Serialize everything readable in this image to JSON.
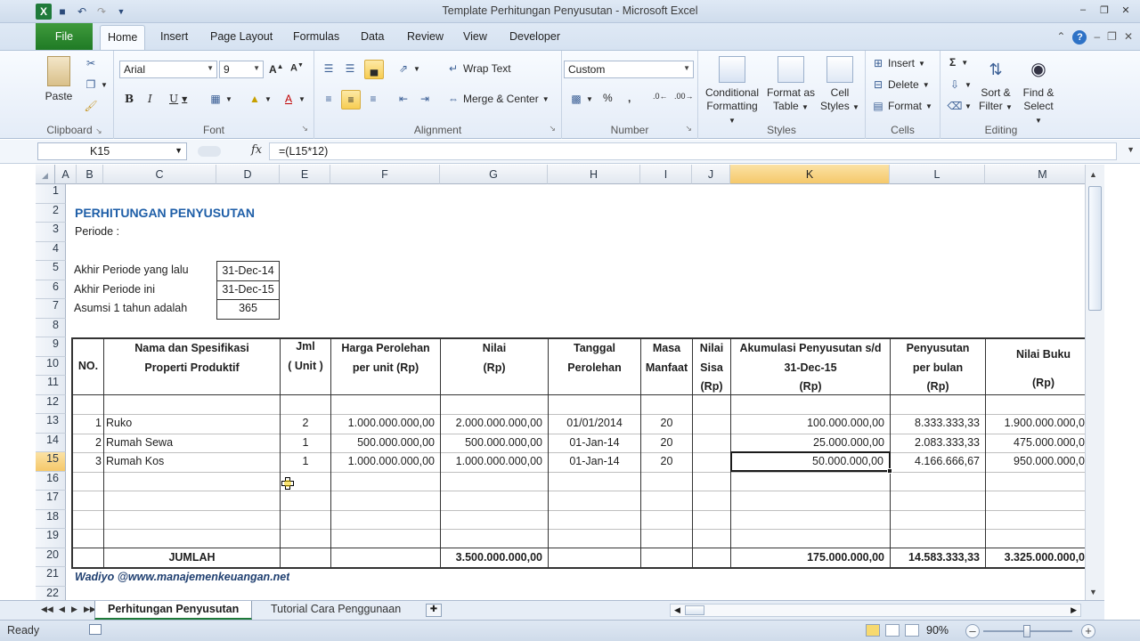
{
  "window": {
    "title": "Template Perhitungan Penyusutan  -  Microsoft Excel"
  },
  "ribbon": {
    "tabs": [
      "File",
      "Home",
      "Insert",
      "Page Layout",
      "Formulas",
      "Data",
      "Review",
      "View",
      "Developer"
    ],
    "active_tab": "Home",
    "clipboard": {
      "paste": "Paste",
      "label": "Clipboard"
    },
    "font": {
      "name": "Arial",
      "size": "9",
      "label": "Font"
    },
    "alignment": {
      "wrap_text": "Wrap Text",
      "merge_center": "Merge & Center",
      "label": "Alignment"
    },
    "number": {
      "format": "Custom",
      "label": "Number"
    },
    "styles": {
      "conditional": [
        "Conditional",
        "Formatting"
      ],
      "format_table": [
        "Format as",
        "Table"
      ],
      "cell_styles": [
        "Cell",
        "Styles"
      ],
      "label": "Styles"
    },
    "cells": {
      "insert": "Insert",
      "delete": "Delete",
      "format": "Format",
      "label": "Cells"
    },
    "editing": {
      "sort_filter": [
        "Sort &",
        "Filter"
      ],
      "find_select": [
        "Find &",
        "Select"
      ],
      "label": "Editing"
    }
  },
  "formula_bar": {
    "name_box": "K15",
    "formula": "=(L15*12)"
  },
  "columns": [
    "A",
    "B",
    "C",
    "D",
    "E",
    "F",
    "G",
    "H",
    "I",
    "J",
    "K",
    "L",
    "M"
  ],
  "rows": [
    "1",
    "2",
    "3",
    "4",
    "5",
    "6",
    "7",
    "8",
    "9",
    "10",
    "11",
    "12",
    "13",
    "14",
    "15",
    "16",
    "17",
    "18",
    "19",
    "20",
    "21",
    "22"
  ],
  "selected": {
    "column": "K",
    "row": "15"
  },
  "sheet": {
    "title": "PERHITUNGAN PENYUSUTAN",
    "periode": "Periode :",
    "params": [
      {
        "label": "Akhir Periode yang lalu",
        "value": "31-Dec-14"
      },
      {
        "label": "Akhir Periode ini",
        "value": "31-Dec-15"
      },
      {
        "label": "Asumsi 1 tahun adalah",
        "value": "365"
      }
    ],
    "headers": {
      "no": "NO.",
      "nama": [
        "Nama dan Spesifikasi",
        "Properti Produktif"
      ],
      "jml": [
        "Jml",
        "( Unit )"
      ],
      "harga": [
        "Harga Perolehan",
        "per unit (Rp)"
      ],
      "nilai": [
        "Nilai",
        "(Rp)"
      ],
      "tanggal": [
        "Tanggal",
        "Perolehan"
      ],
      "masa": [
        "Masa",
        "Manfaat"
      ],
      "sisa": [
        "Nilai",
        "Sisa",
        "(Rp)"
      ],
      "akum": [
        "Akumulasi Penyusutan s/d",
        "31-Dec-15",
        "(Rp)"
      ],
      "penyusutan": [
        "Penyusutan",
        "per bulan",
        "(Rp)"
      ],
      "buku": [
        "Nilai Buku",
        "(Rp)"
      ]
    },
    "data": [
      {
        "no": "1",
        "nama": "Ruko",
        "jml": "2",
        "harga": "1.000.000.000,00",
        "nilai": "2.000.000.000,00",
        "tanggal": "01/01/2014",
        "masa": "20",
        "akum": "100.000.000,00",
        "penyusutan": "8.333.333,33",
        "buku": "1.900.000.000,0"
      },
      {
        "no": "2",
        "nama": "Rumah Sewa",
        "jml": "1",
        "harga": "500.000.000,00",
        "nilai": "500.000.000,00",
        "tanggal": "01-Jan-14",
        "masa": "20",
        "akum": "25.000.000,00",
        "penyusutan": "2.083.333,33",
        "buku": "475.000.000,0"
      },
      {
        "no": "3",
        "nama": "Rumah Kos",
        "jml": "1",
        "harga": "1.000.000.000,00",
        "nilai": "1.000.000.000,00",
        "tanggal": "01-Jan-14",
        "masa": "20",
        "akum": "50.000.000,00",
        "penyusutan": "4.166.666,67",
        "buku": "950.000.000,0"
      }
    ],
    "total": {
      "label": "JUMLAH",
      "nilai": "3.500.000.000,00",
      "akum": "175.000.000,00",
      "penyusutan": "14.583.333,33",
      "buku": "3.325.000.000,0"
    },
    "footer": "Wadiyo @www.manajemenkeuangan.net"
  },
  "sheet_tabs": [
    "Perhitungan Penyusutan",
    "Tutorial Cara Penggunaan"
  ],
  "status": {
    "text": "Ready",
    "zoom": "90%"
  },
  "colors": {
    "title_blue": "#1f5fa8",
    "excel_green": "#1f7a3a",
    "selection_header": "#f5c86a"
  }
}
